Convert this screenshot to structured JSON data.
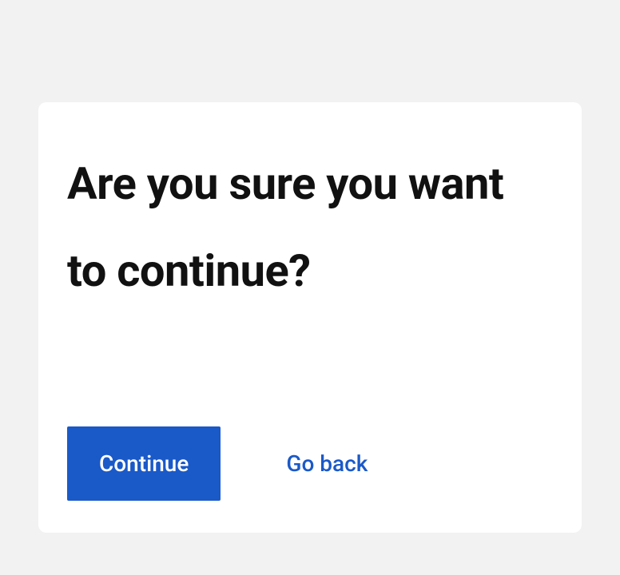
{
  "dialog": {
    "title": "Are you sure you want to continue?",
    "primary_label": "Continue",
    "secondary_label": "Go back"
  }
}
